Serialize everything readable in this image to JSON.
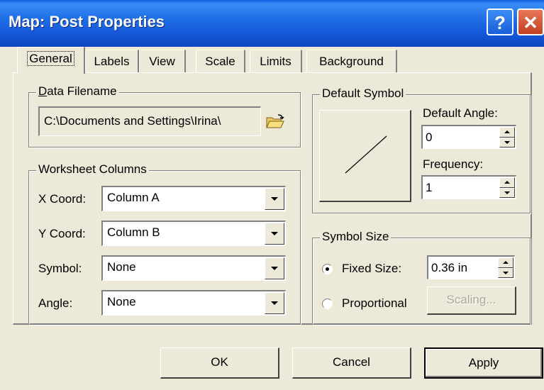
{
  "window": {
    "title": "Map: Post Properties",
    "help_icon": "question-icon",
    "close_icon": "close-icon"
  },
  "tabs": [
    {
      "label": "General",
      "active": true
    },
    {
      "label": "Labels"
    },
    {
      "label": "View"
    },
    {
      "label": "Scale"
    },
    {
      "label": "Limits"
    },
    {
      "label": "Background"
    }
  ],
  "data_filename": {
    "group_label": "Data Filename",
    "value": "C:\\Documents and Settings\\Irina\\",
    "browse_icon": "open-folder-icon"
  },
  "worksheet_columns": {
    "group_label": "Worksheet Columns",
    "x_label": "X Coord:",
    "x_value": "Column A",
    "y_label": "Y Coord:",
    "y_value": "Column B",
    "symbol_label": "Symbol:",
    "symbol_value": "None",
    "angle_label": "Angle:",
    "angle_value": "None"
  },
  "default_symbol": {
    "group_label": "Default Symbol",
    "angle_label": "Default Angle:",
    "angle_value": "0",
    "frequency_label": "Frequency:",
    "frequency_value": "1"
  },
  "symbol_size": {
    "group_label": "Symbol Size",
    "fixed_label": "Fixed Size:",
    "fixed_value": "0.36 in",
    "proportional_label": "Proportional",
    "scaling_label": "Scaling...",
    "selected": "fixed"
  },
  "buttons": {
    "ok": "OK",
    "cancel": "Cancel",
    "apply": "Apply"
  }
}
